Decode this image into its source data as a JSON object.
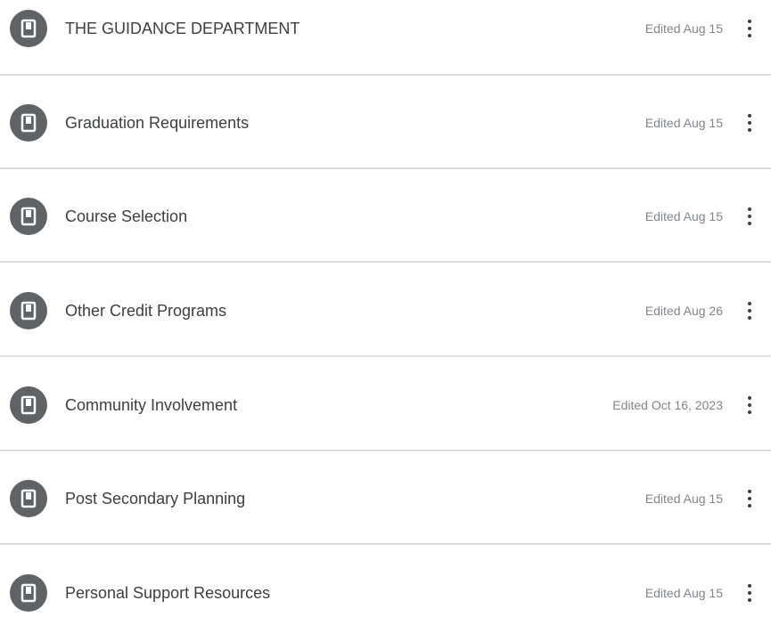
{
  "pages": [
    {
      "icon": "page-icon",
      "title": "THE GUIDANCE DEPARTMENT",
      "edited": "Edited Aug 15",
      "menu_icon": "more-vert-icon"
    },
    {
      "icon": "page-icon",
      "title": "Graduation Requirements",
      "edited": "Edited Aug 15",
      "menu_icon": "more-vert-icon"
    },
    {
      "icon": "page-icon",
      "title": "Course Selection",
      "edited": "Edited Aug 15",
      "menu_icon": "more-vert-icon"
    },
    {
      "icon": "page-icon",
      "title": "Other Credit Programs",
      "edited": "Edited Aug 26",
      "menu_icon": "more-vert-icon"
    },
    {
      "icon": "page-icon",
      "title": "Community Involvement",
      "edited": "Edited Oct 16, 2023",
      "menu_icon": "more-vert-icon"
    },
    {
      "icon": "page-icon",
      "title": "Post Secondary Planning",
      "edited": "Edited Aug 15",
      "menu_icon": "more-vert-icon"
    },
    {
      "icon": "page-icon",
      "title": "Personal Support Resources",
      "edited": "Edited Aug 15",
      "menu_icon": "more-vert-icon"
    }
  ],
  "colors": {
    "icon_background": "#5f6368",
    "title_text": "#3c4043",
    "edited_text": "#80868b",
    "divider": "#dedede"
  }
}
